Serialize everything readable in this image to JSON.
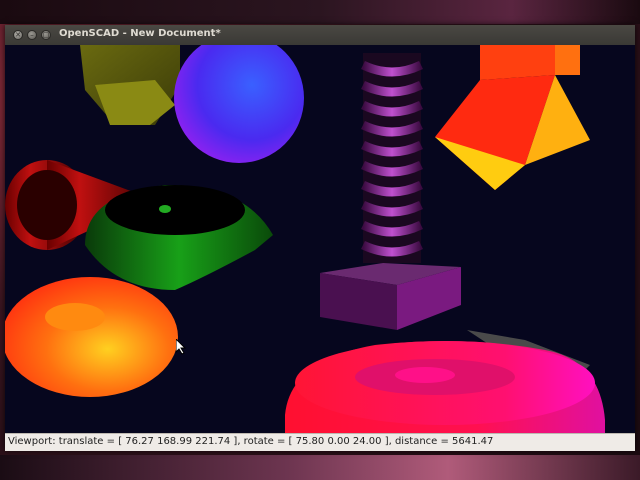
{
  "window": {
    "title": "OpenSCAD - New Document*"
  },
  "statusbar": {
    "text": "Viewport: translate = [ 76.27 168.99 221.74 ], rotate = [ 75.80 0.00 24.00 ], distance = 5641.47"
  },
  "viewport": {
    "background": "#06061e",
    "objects": [
      "pentagon-prism-olive",
      "sphere-blue",
      "twisted-column-purple",
      "box-base-purple",
      "pyramid-frustum-orange",
      "cone-red",
      "torus-green",
      "torus-orange",
      "cylinder-disk-red-magenta",
      "cube-gray"
    ]
  }
}
